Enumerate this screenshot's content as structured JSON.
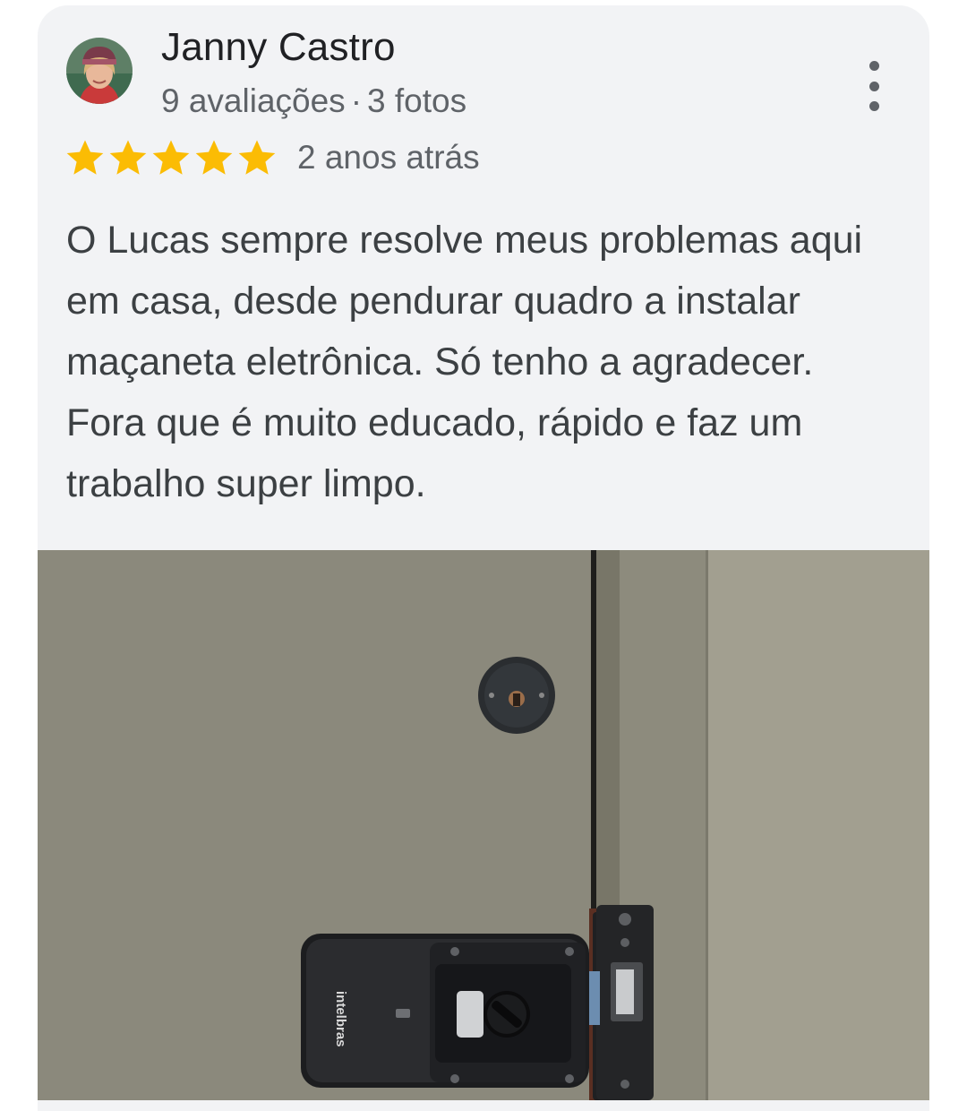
{
  "review": {
    "author_name": "Janny Castro",
    "reviews_count": "9 avaliações",
    "meta_separator": "·",
    "photos_count": "3 fotos",
    "rating": 5,
    "rating_max": 5,
    "time_ago": "2 anos atrás",
    "text": "O Lucas sempre resolve meus problemas aqui em casa, desde pendurar quadro a instalar maçaneta eletrônica. Só tenho a agradecer. Fora que é muito educado, rápido e faz um trabalho super limpo.",
    "photo": {
      "brand_text": "intelbras"
    }
  },
  "icons": {
    "avatar": "avatar-photo",
    "menu": "more-vertical-icon",
    "star": "star-icon"
  },
  "colors": {
    "card_background": "#f2f3f5",
    "star": "#fbbc04",
    "name": "#202124",
    "secondary_text": "#5f6368",
    "body_text": "#3c4043"
  }
}
